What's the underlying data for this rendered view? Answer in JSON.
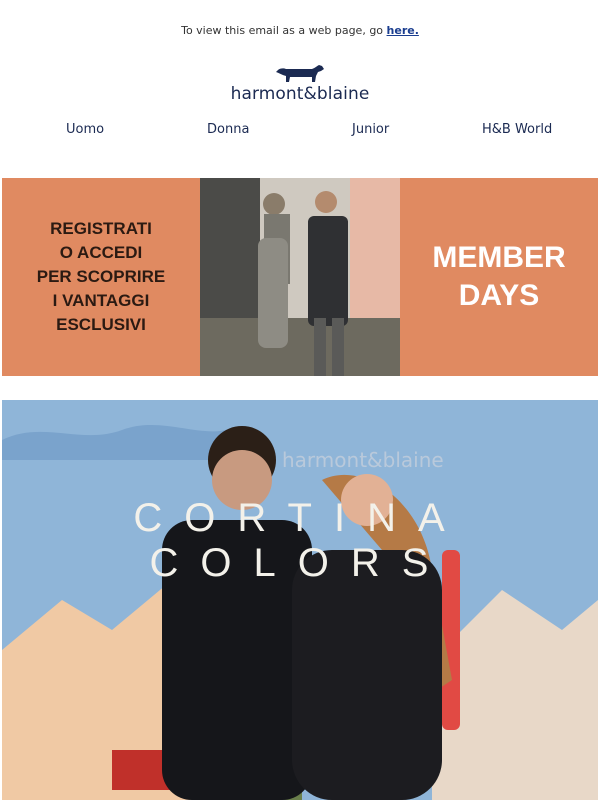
{
  "header": {
    "view_note": "To view this email as a web page, go",
    "view_link": "here.",
    "brand": "harmont&blaine"
  },
  "nav": {
    "items": [
      "Uomo",
      "Donna",
      "Junior",
      "H&B World"
    ]
  },
  "banner": {
    "left_text": "REGISTRATI\nO ACCEDI\nPER SCOPRIRE\nI VANTAGGI\nESCLUSIVI",
    "right_text": "MEMBER\nDAYS",
    "bg_color": "#e08a61"
  },
  "hero": {
    "backdrop_text": "CORTINA COLORS",
    "backdrop_brand": "harmont&blaine"
  },
  "colors": {
    "brand_navy": "#1b2a52",
    "banner_orange": "#e08a61"
  }
}
